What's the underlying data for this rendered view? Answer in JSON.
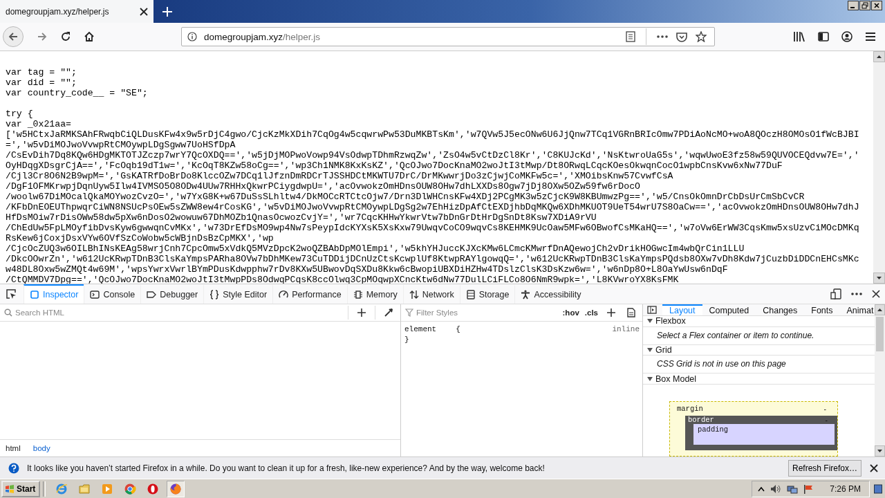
{
  "browser": {
    "tabs": [
      {
        "title": "domegroupjam.xyz/helper.js",
        "selected": true
      }
    ],
    "address_bar": {
      "domain": "domegroupjam.xyz",
      "path": "/helper.js"
    }
  },
  "page": {
    "declarations": [
      "var tag = \"\";",
      "var did = \"\";",
      "var country_code__ = \"SE\";"
    ],
    "lines": [
      "try {",
      "var _0x21aa=",
      "['w5HCtxJaRMKSAhFRwqbCiQLDusKFw4x9w5rDjC4gwo/CjcKzMkXDih7CqOg4w5cqwrwPw53DuMKBTsKm','w7QVw5J5ecONw6U6JjQnw7TCq1VGRnBRIcOmw7PDiAoNcMO+woA8QOczH8OMOsO1fWcBJBI",
      "=','w5vDiMOJwoVvwpRtCMOywpLDgSgww7UoHSfDpA",
      "/CsEvDih7Dq8KQw6HDgMKTOTJZczp7wrY7QcOXDQ==','w5jDjMOPwoVowp94VsOdwpTDhmRzwqZw','ZsO4w5vCtDzCl8Kr','C8KUJcKd','NsKtwroUaG5s','wqwUwoE3fz58w59QUVOCEQdvw7E=','",
      "OyHDqgXDsgrCjA==','FcOqb19dT1w=','KcOqT8KZw58oCg==','wp3Ch1NMK8KxKsKZ','QcOJwo7DocKnaMO2woJtI3tMwp/Dt8ORwqLCqcKOesOkwqnCocO1wpbCnsKvw6xNw77DuF",
      "/Cjl3Cr8O6N2B9wpM=','GsKATRfDoBrDo8KlccOZw7DCq1lJfznDmRDCrTJSSHDCtMKWTU7DrC/DrMKwwrjDo3zCjwjCoMKFw5c=','XMOibsKnw57CvwfCsA",
      "/DgF1OFMKrwpjDqnUyw5Ilw4IVMSO5O8ODw4UUw7RHHxQkwrPCiygdwpU=','acOvwokzOmHDnsOUW8OHw7dhLXXDs8Ogw7jDj8OXw5OZw59fw6rDocO",
      "/woolw67DiMOcalQkaMOYwozCvzO=','w7YxG8K+w67DuSsSLhltw4/DkMOCcRTCtcOjw7/Drn3DlWHCnsKFw4XDj2PCgMK3w5zCjcK9W8KBUmwzPg==','w5/CnsOkOmnDrCbDsUrCmSbCvCR",
      "/KFbDnEOEUThpwqrCiWN8NSUcPsOEw5sZWW8ew4rCosKG','w5vDiMOJwoVvwpRtCMOywpLDgSg2w7EhHizDpAfCtEXDjhbDqMKQw6XDhMKUOT9UeT54wrU7S8OaCw==','acOvwokzOmHDnsOUW8OHw7dhJ",
      "HfDsMOiw7rDisOWw58dw5pXw6nDosO2wowuw67DhMOZb1QnasOcwozCvjY=','wr7CqcKHHwYkwrVtw7bDnGrDtHrDgSnDt8Ksw7XDiA9rVU",
      "/ChEdUw5FpLMOyfibDvsKyw6gwwqnCvMKx','w73DrEfDsMO9wp4Nw7sPeypIdcKYXsK5XsKxw79UwqvCoCO9wqvCs8KEHMK9UcOaw5MFw6OBwofCsMKaHQ==','w7oVw6ErWW3CqsKmw5xsUzvCiMOcDMKq",
      "RsKew6jCoxjDsxVYw6OVfSzCoWobw5cWBjnDsBzCpMKX','wp",
      "/CjcOcZUQ3w6OILBhINsKEAg58wrjCnh7CpcOmw5xVdkQ5MVzDpcK2woQZBAbDpMOlEmpi','w5khYHJuccKJXcKMw6LCmcKMwrfDnAQewojCh2vDrikHOGwcIm4wbQrCin1LLU",
      "/DkcOOwrZn','w612UcKRwpTDnB3ClsKaYmpsPARha8OVw7bDhMKew73CuTDDijDCnUzCtsKcwplUf8KtwpRAYlgowqQ=','w612UcKRwpTDnB3ClsKaYmpsPQdsb8OXw7vDh8Kdw7jCuzbDiDDCnEHCsMKc",
      "w48DL8Oxw5wZMQt4w69M','wpsYwrxVwrlBYmPDusKdwpphw7rDv8KXw5UBwovDqSXDu8Kkw6cBwopiUBXDiHZHw4TDslzClsK3DsKzw6w=','w6nDp8O+L8OaYwUsw6nDqF",
      "/CtQMMDV7Dpg==','QcOJwo7DocKnaMO2woJtI3tMwpPDs8OdwqPCqsK8ccOlwq3CpMOqwpXCncKtw6dNw77DulLCiFLCo8O6NmR9wpk=','L8KVwroYX8KsFMK"
    ]
  },
  "devtools": {
    "tabs": [
      {
        "kind": "inspector",
        "label": "Inspector",
        "selected": true
      },
      {
        "kind": "console",
        "label": "Console",
        "selected": false
      },
      {
        "kind": "debugger",
        "label": "Debugger",
        "selected": false
      },
      {
        "kind": "braces",
        "label": "Style Editor",
        "selected": false
      },
      {
        "kind": "performance",
        "label": "Performance",
        "selected": false
      },
      {
        "kind": "memory",
        "label": "Memory",
        "selected": false
      },
      {
        "kind": "network",
        "label": "Network",
        "selected": false
      },
      {
        "kind": "storage",
        "label": "Storage",
        "selected": false
      },
      {
        "kind": "accessibility",
        "label": "Accessibility",
        "selected": false
      }
    ],
    "html_search": {
      "placeholder": "Search HTML"
    },
    "breadcrumbs": [
      {
        "label": "html",
        "selected": false
      },
      {
        "label": "body",
        "selected": true
      }
    ],
    "rules": {
      "filter": {
        "placeholder": "Filter Styles"
      },
      "toggles": [
        ":hov",
        ".cls"
      ],
      "selector": "element",
      "open_brace": "{",
      "close_brace": "}",
      "source": "inline"
    },
    "layout": {
      "tabs": [
        {
          "label": "Layout",
          "selected": true
        },
        {
          "label": "Computed",
          "selected": false
        },
        {
          "label": "Changes",
          "selected": false
        },
        {
          "label": "Fonts",
          "selected": false
        },
        {
          "label": "Animat",
          "selected": false
        }
      ],
      "sections": [
        {
          "title": "Flexbox",
          "expanded": true,
          "message": "Select a Flex container or item to continue."
        },
        {
          "title": "Grid",
          "expanded": true,
          "message": "CSS Grid is not in use on this page"
        },
        {
          "title": "Box Model",
          "expanded": true
        }
      ],
      "box_model": {
        "margin": "margin",
        "margin_value": "-",
        "border": "border",
        "border_value": "-",
        "padding": "padding"
      }
    }
  },
  "notification": {
    "message": "It looks like you haven’t started Firefox in a while. Do you want to clean it up for a fresh, like-new experience? And by the way, welcome back!",
    "button": "Refresh Firefox…"
  },
  "taskbar": {
    "start": "Start",
    "apps": [
      {
        "kind": "ie",
        "selected": false
      },
      {
        "kind": "folder",
        "selected": false
      },
      {
        "kind": "media",
        "selected": false
      },
      {
        "kind": "chrome",
        "selected": false
      },
      {
        "kind": "opera",
        "selected": false
      },
      {
        "kind": "firefox",
        "selected": true
      }
    ],
    "time": "7:26 PM"
  }
}
